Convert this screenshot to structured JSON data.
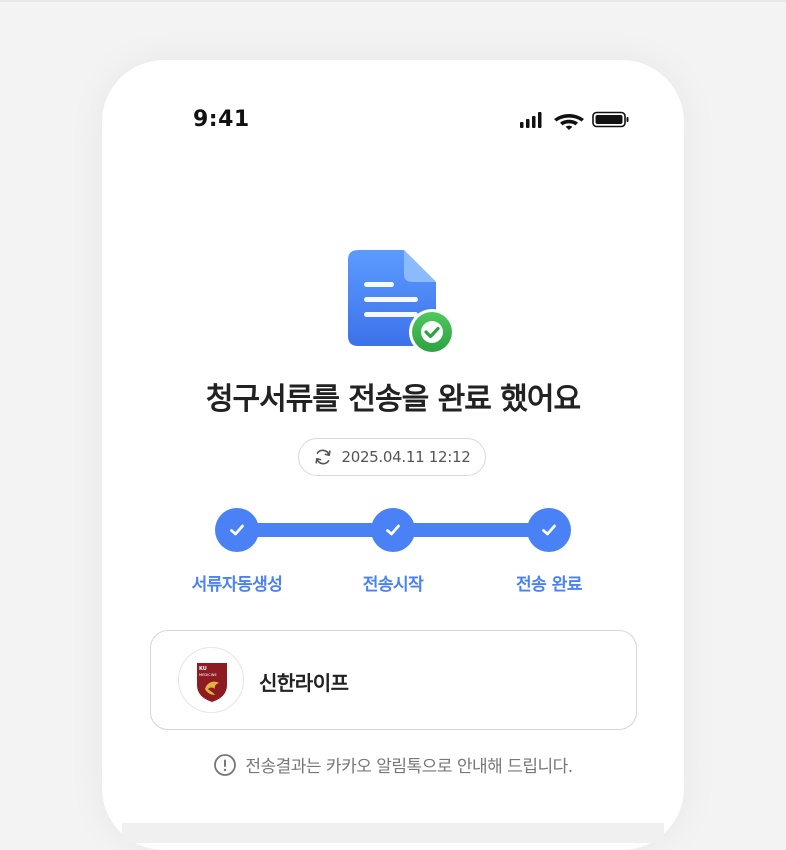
{
  "status_bar": {
    "time": "9:41"
  },
  "result": {
    "headline": "청구서류를 전송을 완료 했어요",
    "timestamp": "2025.04.11 12:12"
  },
  "steps": [
    {
      "label": "서류자동생성",
      "done": true
    },
    {
      "label": "전송시작",
      "done": true
    },
    {
      "label": "전송 완료",
      "done": true
    }
  ],
  "insurer": {
    "name": "신한라이프",
    "logo_text": "KU MEDICINE"
  },
  "notice": {
    "text": "전송결과는 카카오 알림톡으로 안내해 드립니다."
  },
  "colors": {
    "accent": "#4a82f5",
    "success": "#3bb54a"
  }
}
